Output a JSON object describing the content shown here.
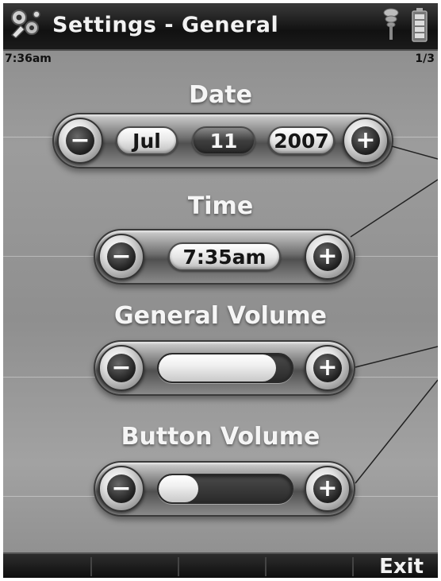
{
  "header": {
    "title": "Settings - General",
    "app_icon": "settings-gears-icon",
    "signal_icon": "signal-strength-icon",
    "battery_icon": "battery-icon"
  },
  "status": {
    "clock": "7:36am",
    "page": "1/3"
  },
  "date": {
    "label": "Date",
    "month": "Jul",
    "day": "11",
    "year": "2007"
  },
  "time": {
    "label": "Time",
    "value": "7:35am"
  },
  "general_volume": {
    "label": "General Volume",
    "level": 0.88
  },
  "button_volume": {
    "label": "Button Volume",
    "level": 0.3
  },
  "buttons": {
    "minus": "−",
    "plus": "+"
  },
  "footer": {
    "exit_label": "Exit"
  }
}
